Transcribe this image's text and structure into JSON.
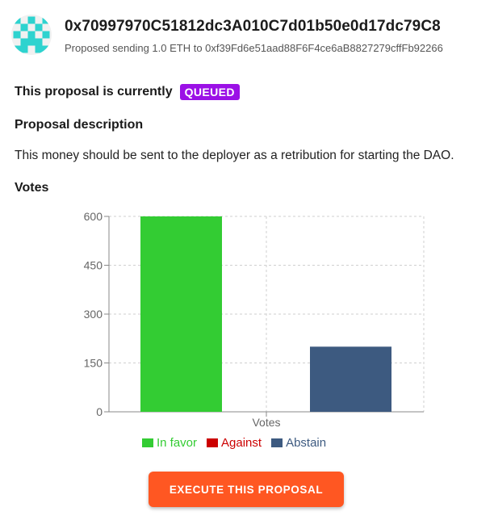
{
  "header": {
    "address": "0x70997970C51812dc3A010C7d01b50e0d17dc79C8",
    "subtitle": "Proposed sending 1.0 ETH to 0xf39Fd6e51aad88F6F4ce6aB8827279cffFb92266",
    "avatar_color": "#2ed3cf"
  },
  "status": {
    "label": "This proposal is currently",
    "badge": "QUEUED",
    "badge_color": "#9b10e6"
  },
  "description": {
    "heading": "Proposal description",
    "text": "This money should be sent to the deployer as a retribution for starting the DAO."
  },
  "votes": {
    "heading": "Votes"
  },
  "chart_data": {
    "type": "bar",
    "categories": [
      "Votes"
    ],
    "xlabel": "Votes",
    "ylim": [
      0,
      600
    ],
    "yticks": [
      0,
      150,
      300,
      450,
      600
    ],
    "grid": true,
    "legend_position": "bottom",
    "series": [
      {
        "name": "In favor",
        "values": [
          600
        ],
        "color": "#33cc33"
      },
      {
        "name": "Against",
        "values": [
          0
        ],
        "color": "#cc0000"
      },
      {
        "name": "Abstain",
        "values": [
          200
        ],
        "color": "#3d5a80"
      }
    ]
  },
  "actions": {
    "execute_label": "EXECUTE THIS PROPOSAL",
    "execute_color": "#ff5722"
  }
}
